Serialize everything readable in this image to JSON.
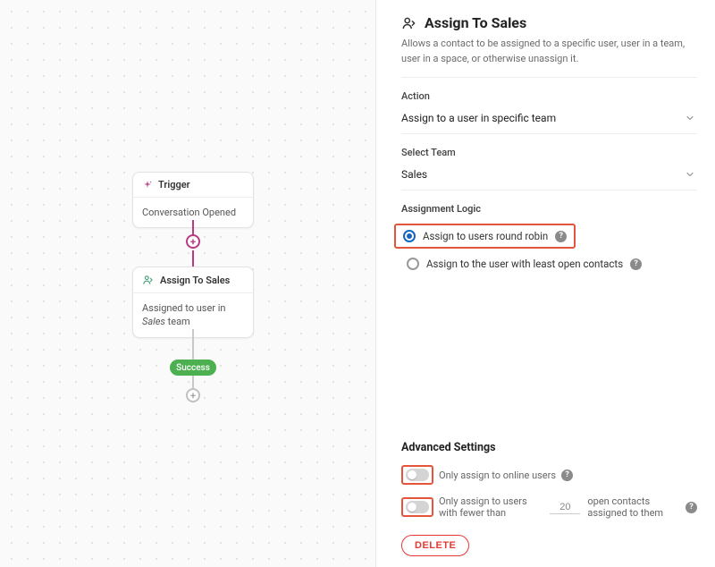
{
  "canvas": {
    "trigger": {
      "title": "Trigger",
      "body": "Conversation Opened"
    },
    "assignNode": {
      "title": "Assign To Sales",
      "body_prefix": "Assigned to user in ",
      "body_team": "Sales",
      "body_suffix": " team"
    },
    "success_label": "Success"
  },
  "panel": {
    "title": "Assign To Sales",
    "description": "Allows a contact to be assigned to a specific user, user in a team, user in a space, or otherwise unassign it.",
    "action_label": "Action",
    "action_value": "Assign to a user in specific team",
    "team_label": "Select Team",
    "team_value": "Sales",
    "logic_label": "Assignment Logic",
    "logic_opt1": "Assign to users round robin",
    "logic_opt2": "Assign to the user with least open contacts",
    "advanced_title": "Advanced Settings",
    "adv_online": "Only assign to online users",
    "adv_fewer_prefix": "Only assign to users with fewer than",
    "adv_fewer_value": "20",
    "adv_fewer_suffix": "open contacts assigned to them",
    "delete_label": "DELETE"
  }
}
